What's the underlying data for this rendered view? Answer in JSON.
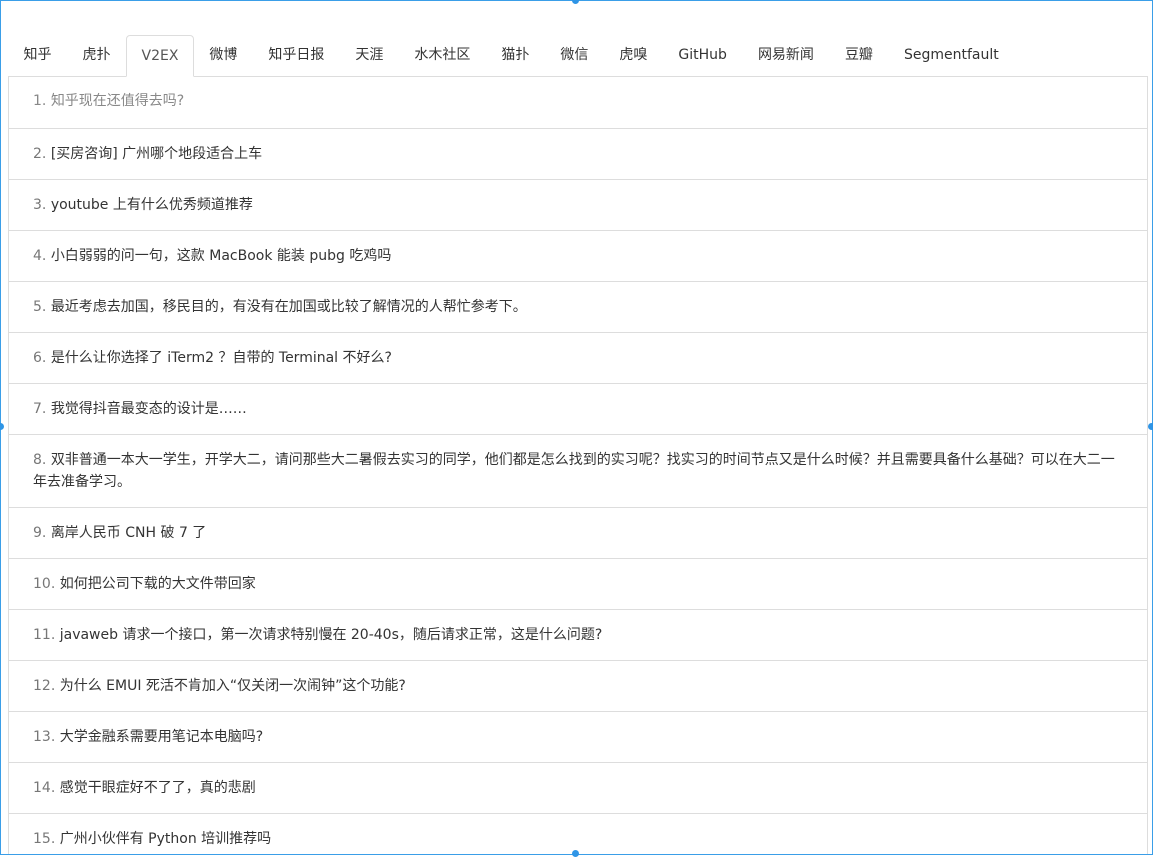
{
  "tabs": [
    {
      "label": "知乎",
      "active": false
    },
    {
      "label": "虎扑",
      "active": false
    },
    {
      "label": "V2EX",
      "active": true
    },
    {
      "label": "微博",
      "active": false
    },
    {
      "label": "知乎日报",
      "active": false
    },
    {
      "label": "天涯",
      "active": false
    },
    {
      "label": "水木社区",
      "active": false
    },
    {
      "label": "猫扑",
      "active": false
    },
    {
      "label": "微信",
      "active": false
    },
    {
      "label": "虎嗅",
      "active": false
    },
    {
      "label": "GitHub",
      "active": false
    },
    {
      "label": "网易新闻",
      "active": false
    },
    {
      "label": "豆瓣",
      "active": false
    },
    {
      "label": "Segmentfault",
      "active": false
    }
  ],
  "items": [
    {
      "num": "1.",
      "title": "知乎现在还值得去吗?"
    },
    {
      "num": "2.",
      "title": "[买房咨询] 广州哪个地段适合上车"
    },
    {
      "num": "3.",
      "title": "youtube 上有什么优秀频道推荐"
    },
    {
      "num": "4.",
      "title": "小白弱弱的问一句，这款 MacBook 能装 pubg 吃鸡吗"
    },
    {
      "num": "5.",
      "title": "最近考虑去加国，移民目的，有没有在加国或比较了解情况的人帮忙参考下。"
    },
    {
      "num": "6.",
      "title": "是什么让你选择了 iTerm2 ？自带的 Terminal 不好么?"
    },
    {
      "num": "7.",
      "title": "我觉得抖音最变态的设计是……"
    },
    {
      "num": "8.",
      "title": "双非普通一本大一学生，开学大二，请问那些大二暑假去实习的同学，他们都是怎么找到的实习呢？找实习的时间节点又是什么时候？并且需要具备什么基础？可以在大二一年去准备学习。"
    },
    {
      "num": "9.",
      "title": "离岸人民币 CNH 破 7 了"
    },
    {
      "num": "10.",
      "title": "如何把公司下载的大文件带回家"
    },
    {
      "num": "11.",
      "title": "javaweb 请求一个接口，第一次请求特别慢在 20-40s，随后请求正常，这是什么问题?"
    },
    {
      "num": "12.",
      "title": "为什么 EMUI 死活不肯加入“仅关闭一次闹钟”这个功能?"
    },
    {
      "num": "13.",
      "title": "大学金融系需要用笔记本电脑吗?"
    },
    {
      "num": "14.",
      "title": "感觉干眼症好不了了，真的悲剧"
    },
    {
      "num": "15.",
      "title": "广州小伙伴有 Python 培训推荐吗"
    }
  ]
}
